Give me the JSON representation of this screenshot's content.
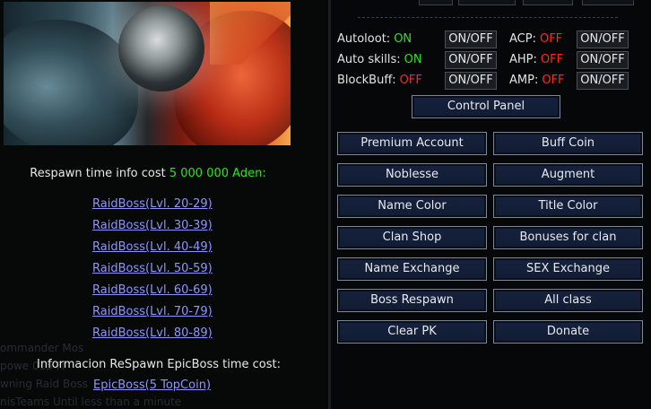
{
  "left": {
    "respawn_info_prefix": "Respawn time info cost ",
    "respawn_info_cost": "5 000 000 Aden",
    "respawn_info_suffix": ":",
    "raid_links": [
      "RaidBoss(Lvl. 20-29)",
      "RaidBoss(Lvl. 30-39)",
      "RaidBoss(Lvl. 40-49)",
      "RaidBoss(Lvl. 50-59)",
      "RaidBoss(Lvl. 60-69)",
      "RaidBoss(Lvl. 70-79)",
      "RaidBoss(Lvl. 80-89)"
    ],
    "epic_info": "Informacion ReSpawn EpicBoss time cost:",
    "epic_link": "EpicBoss(5 TopCoin)",
    "chat_lines": [
      "ommander Mos",
      "powe                                          015 Fr",
      "wning Raid Boss",
      "nisTeams Until                                 less than a minute"
    ]
  },
  "right": {
    "options": [
      {
        "label": "Autoloot:",
        "status": "ON",
        "status_color": "#2fe21f",
        "button": "ON/OFF"
      },
      {
        "label": "ACP:",
        "status": "OFF",
        "status_color": "#ff2a1a",
        "button": "ON/OFF"
      },
      {
        "label": "Auto skills:",
        "status": "ON",
        "status_color": "#2fe21f",
        "button": "ON/OFF"
      },
      {
        "label": "AHP:",
        "status": "OFF",
        "status_color": "#ff2a1a",
        "button": "ON/OFF"
      },
      {
        "label": "BlockBuff:",
        "status": "OFF",
        "status_color": "#ff2a1a",
        "button": "ON/OFF"
      },
      {
        "label": "AMP:",
        "status": "OFF",
        "status_color": "#ff2a1a",
        "button": "ON/OFF"
      }
    ],
    "control_panel": "Control Panel",
    "buttons": [
      "Premium Account",
      "Buff Coin",
      "Noblesse",
      "Augment",
      "Name Color",
      "Title Color",
      "Clan Shop",
      "Bonuses for clan",
      "Name Exchange",
      "SEX Exchange",
      "Boss Respawn",
      "All class",
      "Clear PK",
      "Donate"
    ]
  },
  "colors": {
    "link": "#8f95ff",
    "on": "#2fe21f",
    "off": "#ff2a1a",
    "button_bg": "#16223e",
    "button_border": "#7c8695"
  }
}
